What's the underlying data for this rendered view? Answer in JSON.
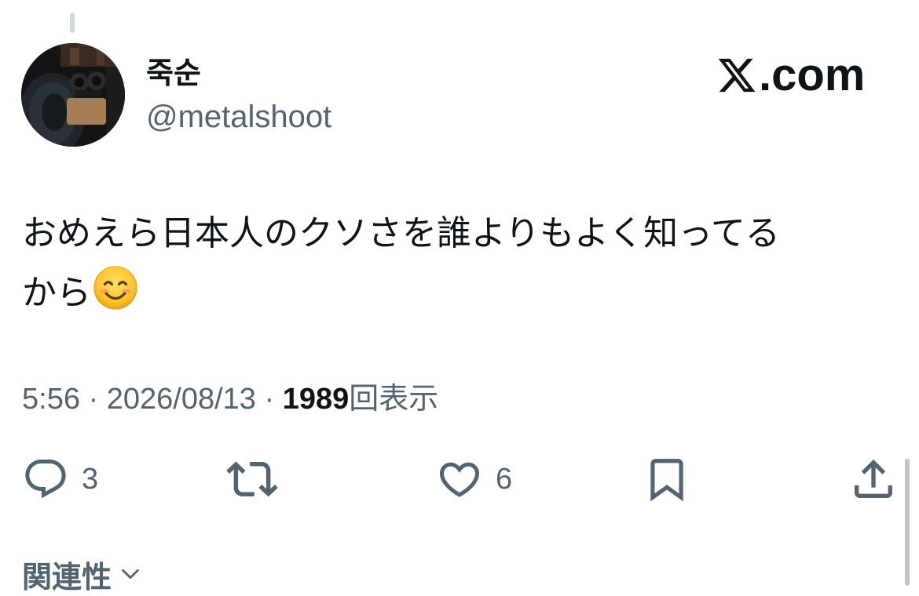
{
  "author": {
    "display_name": "죽순",
    "handle": "@metalshoot",
    "avatar_icon": "avatar-photo"
  },
  "brand": {
    "icon": "x-logo-icon",
    "text": ".com"
  },
  "tweet": {
    "text_line1": "おめえら日本人のクソさを誰よりもよく知ってる",
    "text_line2": "から",
    "emoji": "smiling-face-emoji"
  },
  "meta": {
    "time": "5:56",
    "separator": "·",
    "date": "2026/08/13",
    "views_count": "1989",
    "views_label": "回表示"
  },
  "actions": {
    "reply_count": "3",
    "like_count": "6"
  },
  "related": {
    "label": "関連性"
  },
  "colors": {
    "primary_text": "#0f1419",
    "secondary_text": "#536471",
    "icon": "#536471"
  }
}
